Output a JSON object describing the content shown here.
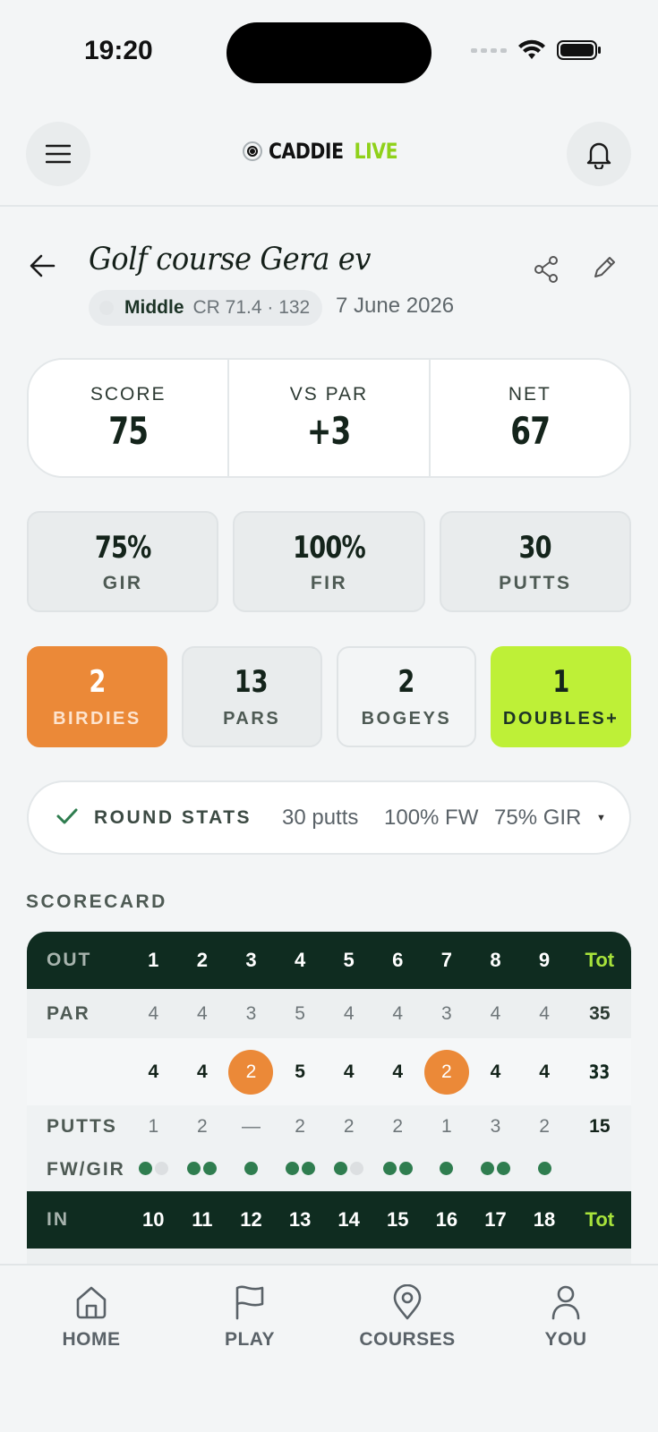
{
  "status_bar": {
    "time": "19:20"
  },
  "header": {
    "logo_primary": "CADDIE",
    "logo_accent": "LIVE"
  },
  "round": {
    "course_name": "Golf course Gera ev",
    "tee_name": "Middle",
    "tee_rating": "CR 71.4 · 132",
    "date": "7 June 2026"
  },
  "summary": [
    {
      "label": "SCORE",
      "value": "75"
    },
    {
      "label": "VS PAR",
      "value": "+3"
    },
    {
      "label": "NET",
      "value": "67"
    }
  ],
  "stats": [
    {
      "value": "75%",
      "label": "GIR"
    },
    {
      "value": "100%",
      "label": "FIR"
    },
    {
      "value": "30",
      "label": "PUTTS"
    }
  ],
  "tallies": [
    {
      "value": "2",
      "label": "BIRDIES"
    },
    {
      "value": "13",
      "label": "PARS"
    },
    {
      "value": "2",
      "label": "BOGEYS"
    },
    {
      "value": "1",
      "label": "DOUBLES+"
    }
  ],
  "round_stats": {
    "label": "ROUND STATS",
    "putts": "30 putts",
    "fw": "100% FW",
    "gir": "75% GIR",
    "caret": "▼"
  },
  "scorecard": {
    "title": "SCORECARD",
    "out": {
      "label": "OUT",
      "holes": [
        "1",
        "2",
        "3",
        "4",
        "5",
        "6",
        "7",
        "8",
        "9"
      ],
      "total_label": "Tot",
      "par_label": "PAR",
      "par": [
        "4",
        "4",
        "3",
        "5",
        "4",
        "4",
        "3",
        "4",
        "4"
      ],
      "par_total": "35",
      "scores": [
        "4",
        "4",
        "2",
        "5",
        "4",
        "4",
        "2",
        "4",
        "4"
      ],
      "score_total": "33",
      "birdie_holes": [
        2,
        6
      ],
      "putts_label": "PUTTS",
      "putts": [
        "1",
        "2",
        "—",
        "2",
        "2",
        "2",
        "1",
        "3",
        "2"
      ],
      "putts_total": "15",
      "fwgir_label": "FW/GIR",
      "fwgir": [
        [
          "hit",
          "miss"
        ],
        [
          "hit",
          "hit"
        ],
        [
          "hit"
        ],
        [
          "hit",
          "hit"
        ],
        [
          "hit",
          "miss"
        ],
        [
          "hit",
          "hit"
        ],
        [
          "hit"
        ],
        [
          "hit",
          "hit"
        ],
        [
          "hit"
        ]
      ]
    },
    "in": {
      "label": "IN",
      "holes": [
        "10",
        "11",
        "12",
        "13",
        "14",
        "15",
        "16",
        "17",
        "18"
      ],
      "total_label": "Tot"
    }
  },
  "tab_bar": [
    {
      "label": "HOME",
      "icon": "home-icon"
    },
    {
      "label": "PLAY",
      "icon": "flag-icon"
    },
    {
      "label": "COURSES",
      "icon": "map-pin-icon"
    },
    {
      "label": "YOU",
      "icon": "user-icon"
    }
  ],
  "colors": {
    "dark_green": "#0f2c20",
    "lime": "#bef037",
    "orange": "#eb8938",
    "fairway_hit": "#2f7d4f"
  }
}
